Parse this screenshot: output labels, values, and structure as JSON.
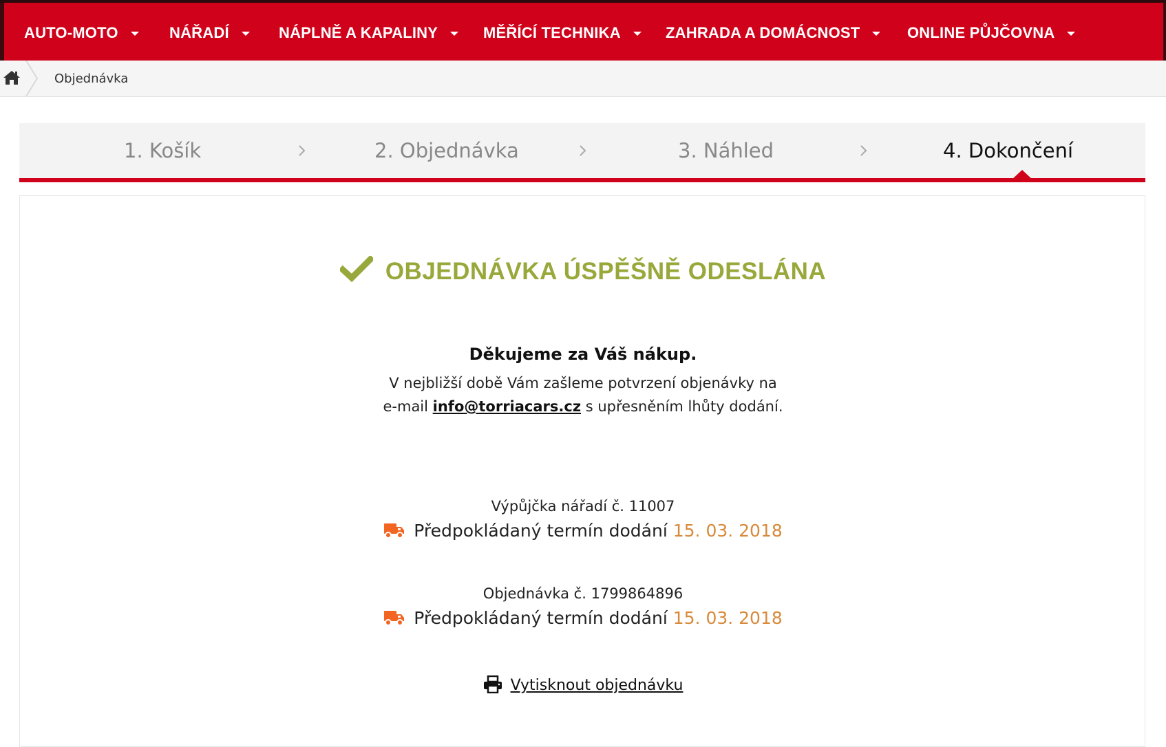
{
  "nav": {
    "items": [
      {
        "label": "AUTO-MOTO"
      },
      {
        "label": "NÁŘADÍ"
      },
      {
        "label": "NÁPLNĚ A KAPALINY"
      },
      {
        "label": "MĚŘÍCÍ TECHNIKA"
      },
      {
        "label": "ZAHRADA A DOMÁCNOST"
      },
      {
        "label": "ONLINE PŮJČOVNA"
      }
    ]
  },
  "breadcrumb": {
    "home_icon": "home-icon",
    "current": "Objednávka"
  },
  "steps": [
    {
      "label": "1. Košík"
    },
    {
      "label": "2. Objednávka"
    },
    {
      "label": "3. Náhled"
    },
    {
      "label": "4. Dokončení",
      "active": true
    }
  ],
  "success": {
    "title": "OBJEDNÁVKA ÚSPĚŠNĚ ODESLÁNA",
    "icon": "check-icon"
  },
  "message": {
    "thanks": "Děkujeme za Váš nákup.",
    "line1": "V nejbližší době Vám zašleme potvrzení objenávky na",
    "line2_prefix": "e-mail ",
    "email": "info@torriacars.cz",
    "line2_suffix": " s upřesněním lhůty dodání."
  },
  "orders": [
    {
      "label": "Výpůjčka nářadí č. 11007",
      "delivery_text": "Předpokládaný termín dodání",
      "delivery_date": "15. 03. 2018",
      "icon": "truck-icon"
    },
    {
      "label": "Objednávka č. 1799864896",
      "delivery_text": "Předpokládaný termín dodání",
      "delivery_date": "15. 03. 2018",
      "icon": "truck-icon"
    }
  ],
  "print": {
    "label": "Vytisknout objednávku",
    "icon": "printer-icon"
  },
  "colors": {
    "brand_red": "#d0021b",
    "success_green": "#98a83a",
    "truck_orange": "#f26522",
    "date_orange": "#d88a3a"
  }
}
